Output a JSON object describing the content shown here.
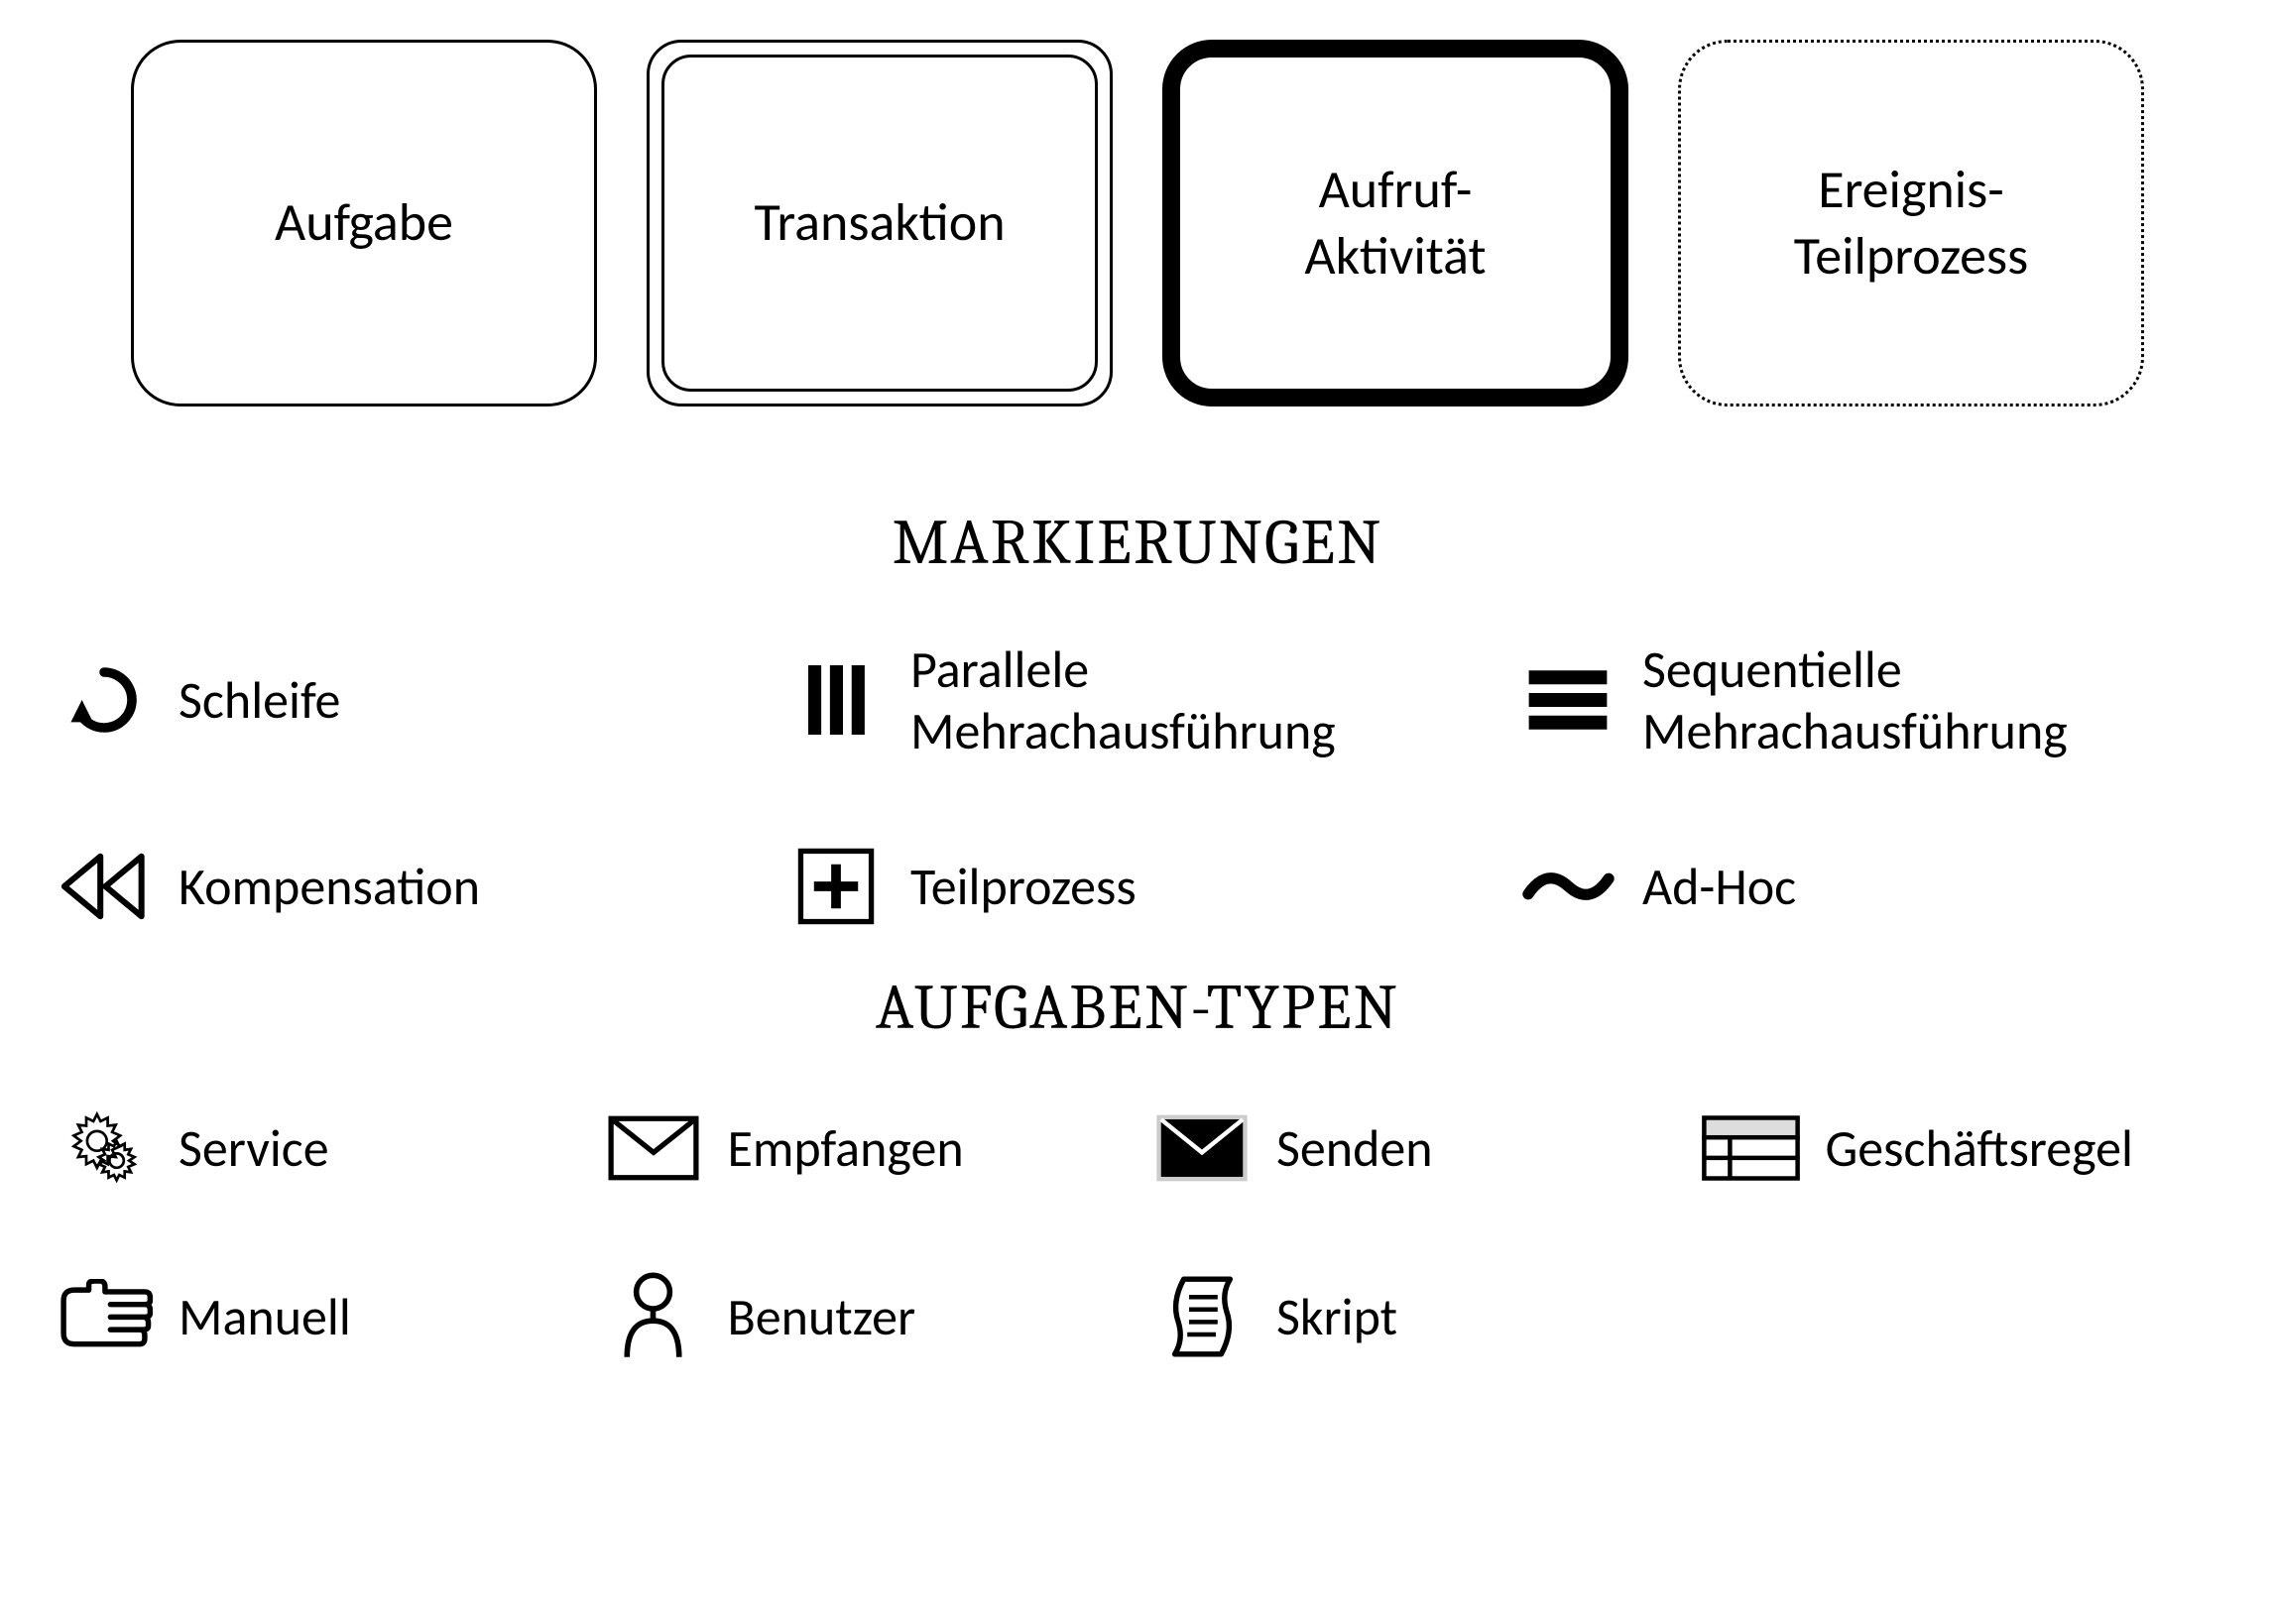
{
  "boxes": {
    "task": "Aufgabe",
    "transaction": "Transaktion",
    "call": "Aufruf-\nAktivität",
    "event": "Ereignis-\nTeilprozess"
  },
  "sections": {
    "markers_title": "MARKIERUNGEN",
    "tasktypes_title": "AUFGABEN-TYPEN"
  },
  "markers": {
    "loop": "Schleife",
    "parallel": "Parallele\nMehrachausführung",
    "sequential": "Sequentielle\nMehrachausführung",
    "compensation": "Kompensation",
    "subprocess": "Teilprozess",
    "adhoc": "Ad-Hoc"
  },
  "tasktypes": {
    "service": "Service",
    "receive": "Empfangen",
    "send": "Senden",
    "businessrule": "Geschäftsregel",
    "manual": "Manuell",
    "user": "Benutzer",
    "script": "Skript"
  }
}
